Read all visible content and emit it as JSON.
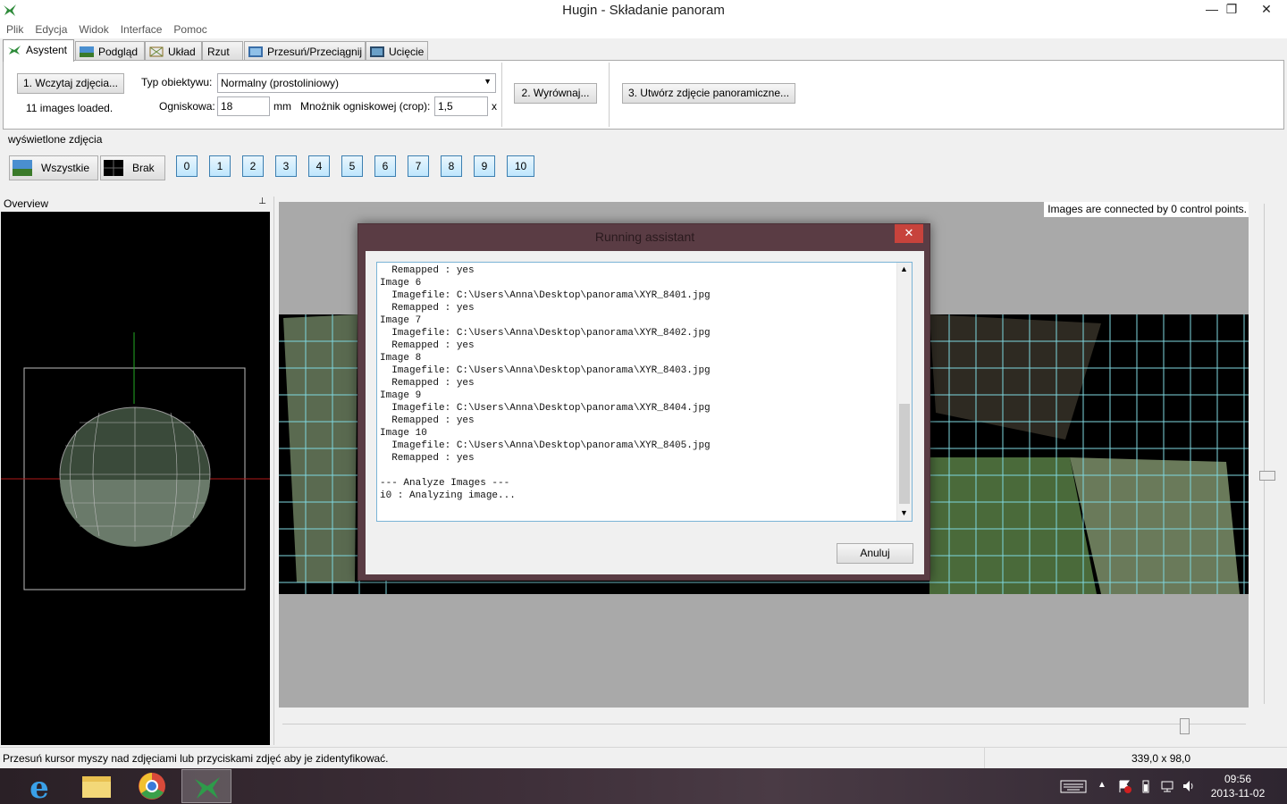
{
  "window": {
    "title": "Hugin - Składanie panoram",
    "minimize": "—",
    "restore": "❐",
    "close": "✕"
  },
  "menu": [
    "Plik",
    "Edycja",
    "Widok",
    "Interface",
    "Pomoc"
  ],
  "tabs": [
    "Asystent",
    "Podgląd",
    "Układ",
    "Rzut",
    "Przesuń/Przeciągnij",
    "Ucięcie"
  ],
  "assistant": {
    "load_button": "1. Wczytaj zdjęcia...",
    "images_loaded": "11 images loaded.",
    "lens_type_label": "Typ obiektywu:",
    "lens_type_value": "Normalny (prostoliniowy)",
    "focal_label": "Ogniskowa:",
    "focal_value": "18",
    "focal_unit": "mm",
    "crop_label": "Mnożnik ogniskowej (crop):",
    "crop_value": "1,5",
    "crop_unit": "x",
    "align_button": "2. Wyrównaj...",
    "create_button": "3. Utwórz zdjęcie panoramiczne..."
  },
  "display": {
    "section_label": "wyświetlone zdjęcia",
    "all_button": "Wszystkie",
    "none_button": "Brak",
    "image_buttons": [
      "0",
      "1",
      "2",
      "3",
      "4",
      "5",
      "6",
      "7",
      "8",
      "9",
      "10"
    ]
  },
  "overview": {
    "title": "Overview",
    "pin": "📌"
  },
  "preview": {
    "control_points_text": "Images are connected by 0 control points."
  },
  "dialog": {
    "title": "Running assistant",
    "close": "✕",
    "log": "  Remapped : yes\nImage 6\n  Imagefile: C:\\Users\\Anna\\Desktop\\panorama\\XYR_8401.jpg\n  Remapped : yes\nImage 7\n  Imagefile: C:\\Users\\Anna\\Desktop\\panorama\\XYR_8402.jpg\n  Remapped : yes\nImage 8\n  Imagefile: C:\\Users\\Anna\\Desktop\\panorama\\XYR_8403.jpg\n  Remapped : yes\nImage 9\n  Imagefile: C:\\Users\\Anna\\Desktop\\panorama\\XYR_8404.jpg\n  Remapped : yes\nImage 10\n  Imagefile: C:\\Users\\Anna\\Desktop\\panorama\\XYR_8405.jpg\n  Remapped : yes\n\n--- Analyze Images ---\ni0 : Analyzing image...",
    "cancel_button": "Anuluj"
  },
  "status": {
    "hint": "Przesuń kursor myszy nad zdjęciami lub przyciskami zdjęć aby je zidentyfikować.",
    "dimensions": "339,0 x 98,0"
  },
  "taskbar": {
    "time": "09:56",
    "date": "2013-11-02"
  }
}
